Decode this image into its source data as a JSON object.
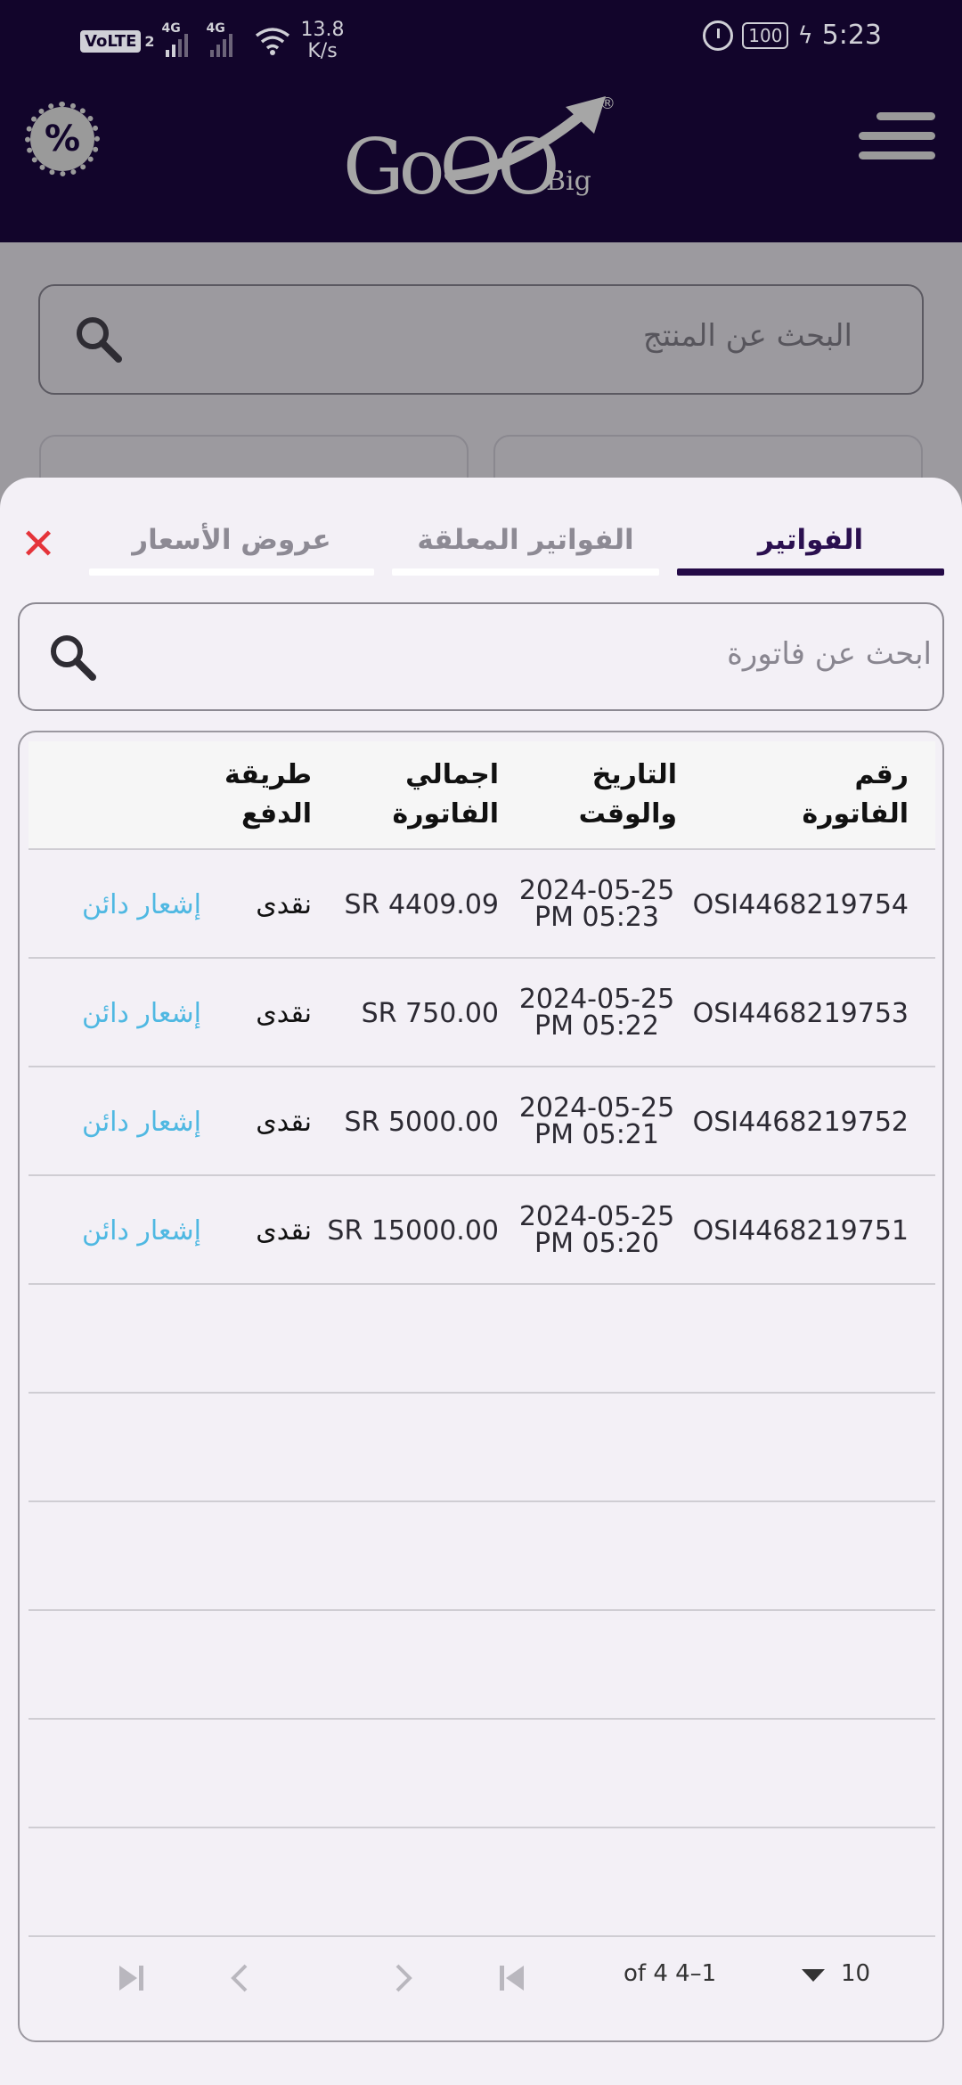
{
  "status_bar": {
    "volte": "VoLTE",
    "sim": "2",
    "network_1": "4G",
    "network_2": "4G",
    "speed_value": "13.8",
    "speed_unit": "K/s",
    "battery": "100",
    "time": "5:23"
  },
  "header": {
    "discount_symbol": "%",
    "logo_text": "GoOO",
    "logo_sub": "Big",
    "logo_mark": "®"
  },
  "background": {
    "product_search_placeholder": "البحث عن المنتج"
  },
  "sheet": {
    "close_symbol": "✕",
    "tabs": [
      {
        "label": "الفواتير",
        "active": true
      },
      {
        "label": "الفواتير المعلقة",
        "active": false
      },
      {
        "label": "عروض الأسعار",
        "active": false
      }
    ],
    "invoice_search_placeholder": "ابحث عن فاتورة"
  },
  "table": {
    "headers": {
      "invoice_number": [
        "رقم",
        "الفاتورة"
      ],
      "date_time": [
        "التاريخ",
        "والوقت"
      ],
      "total": [
        "اجمالي",
        "الفاتورة"
      ],
      "payment_method": [
        "طريقة",
        "الدفع"
      ]
    },
    "rows": [
      {
        "invoice_number": "OSI4468219754",
        "date": "2024-05-25",
        "time": "PM 05:23",
        "total": "SR 4409.09",
        "payment_method": "نقدى",
        "action": "إشعار دائن"
      },
      {
        "invoice_number": "OSI4468219753",
        "date": "2024-05-25",
        "time": "PM 05:22",
        "total": "SR 750.00",
        "payment_method": "نقدى",
        "action": "إشعار دائن"
      },
      {
        "invoice_number": "OSI4468219752",
        "date": "2024-05-25",
        "time": "PM 05:21",
        "total": "SR 5000.00",
        "payment_method": "نقدى",
        "action": "إشعار دائن"
      },
      {
        "invoice_number": "OSI4468219751",
        "date": "2024-05-25",
        "time": "PM 05:20",
        "total": "SR 15000.00",
        "payment_method": "نقدى",
        "action": "إشعار دائن"
      }
    ],
    "empty_rows": 6
  },
  "pagination": {
    "range": "of 4 4–1",
    "page_size": "10",
    "icons": [
      "last-page-icon",
      "next-page-icon",
      "previous-page-icon",
      "first-page-icon"
    ]
  },
  "colors": {
    "header_bg": "#12052b",
    "accent": "#240a47",
    "close": "#e5343a",
    "link": "#4fb8e2",
    "sheet_bg": "#f3f0f6"
  }
}
